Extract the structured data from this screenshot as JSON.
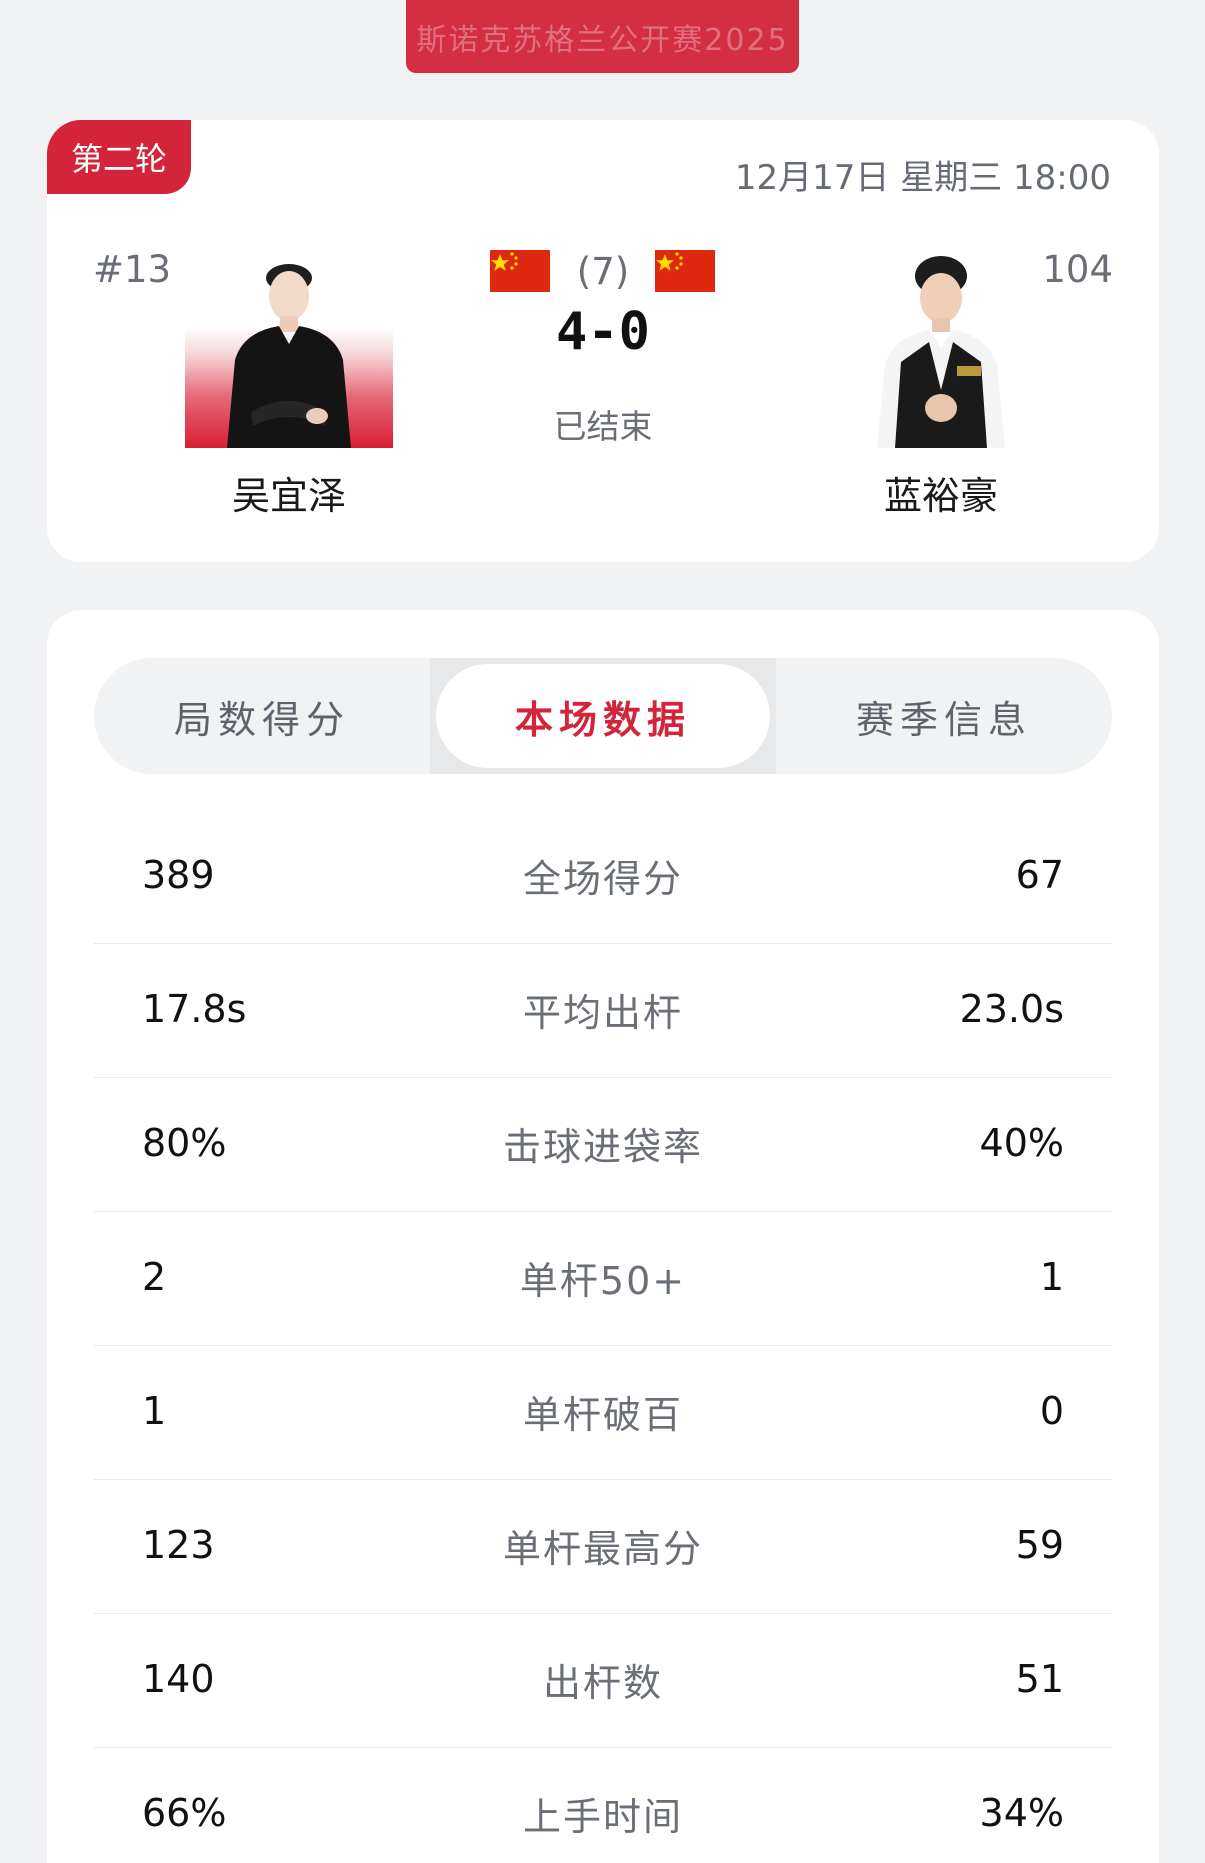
{
  "banner": {
    "text": "斯诺克苏格兰公开赛2025"
  },
  "match": {
    "round": "第二轮",
    "time": "12月17日 星期三 18:00",
    "best_of": "(7)",
    "score": "4-0",
    "status": "已结束",
    "flag_colors": {
      "field": "#de2910",
      "star": "#ffde00"
    },
    "player_left": {
      "seed": "#13",
      "name": "吴宜泽",
      "country_flag": "china-flag-icon"
    },
    "player_right": {
      "seed": "#104",
      "name": "蓝裕豪",
      "country_flag": "china-flag-icon"
    }
  },
  "tabs": [
    {
      "label": "局数得分",
      "active": false
    },
    {
      "label": "本场数据",
      "active": true
    },
    {
      "label": "赛季信息",
      "active": false
    }
  ],
  "stats": [
    {
      "label": "全场得分",
      "left": "389",
      "right": "67"
    },
    {
      "label": "平均出杆",
      "left": "17.8s",
      "right": "23.0s"
    },
    {
      "label": "击球进袋率",
      "left": "80%",
      "right": "40%"
    },
    {
      "label": "单杆50+",
      "left": "2",
      "right": "1"
    },
    {
      "label": "单杆破百",
      "left": "1",
      "right": "0"
    },
    {
      "label": "单杆最高分",
      "left": "123",
      "right": "59"
    },
    {
      "label": "出杆数",
      "left": "140",
      "right": "51"
    },
    {
      "label": "上手时间",
      "left": "66%",
      "right": "34%"
    }
  ],
  "colors": {
    "accent": "#d3243a",
    "background": "#f1f2f4",
    "card": "#ffffff"
  }
}
